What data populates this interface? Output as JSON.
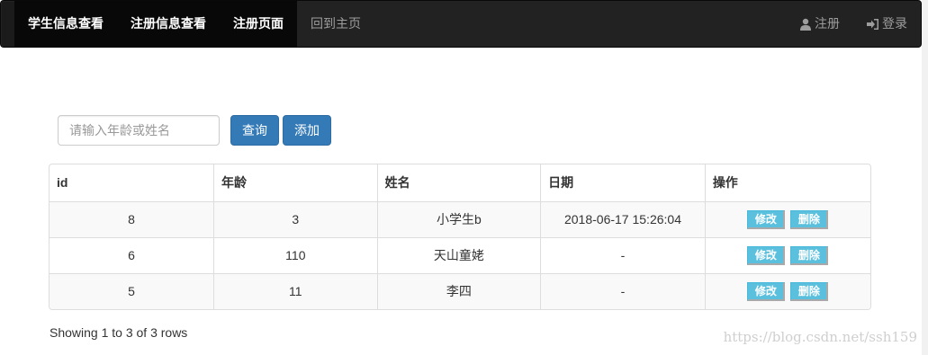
{
  "navbar": {
    "items": [
      {
        "label": "学生信息查看",
        "active": true
      },
      {
        "label": "注册信息查看",
        "active": true
      },
      {
        "label": "注册页面",
        "active": true
      },
      {
        "label": "回到主页",
        "active": false
      }
    ],
    "right": {
      "register_label": "注册",
      "login_label": "登录"
    }
  },
  "search": {
    "placeholder": "请输入年龄或姓名",
    "value": "",
    "query_label": "查询",
    "add_label": "添加"
  },
  "table": {
    "columns": [
      "id",
      "年龄",
      "姓名",
      "日期",
      "操作"
    ],
    "rows": [
      {
        "id": "8",
        "age": "3",
        "name": "小学生b",
        "date": "2018-06-17 15:26:04"
      },
      {
        "id": "6",
        "age": "110",
        "name": "天山童姥",
        "date": "-"
      },
      {
        "id": "5",
        "age": "11",
        "name": "李四",
        "date": "-"
      }
    ],
    "edit_label": "修改",
    "delete_label": "删除"
  },
  "pagination": {
    "info": "Showing 1 to 3 of 3 rows"
  },
  "watermark": "https://blog.csdn.net/ssh159",
  "colors": {
    "navbar_bg": "#222222",
    "primary": "#337ab7",
    "info": "#5bc0de"
  }
}
